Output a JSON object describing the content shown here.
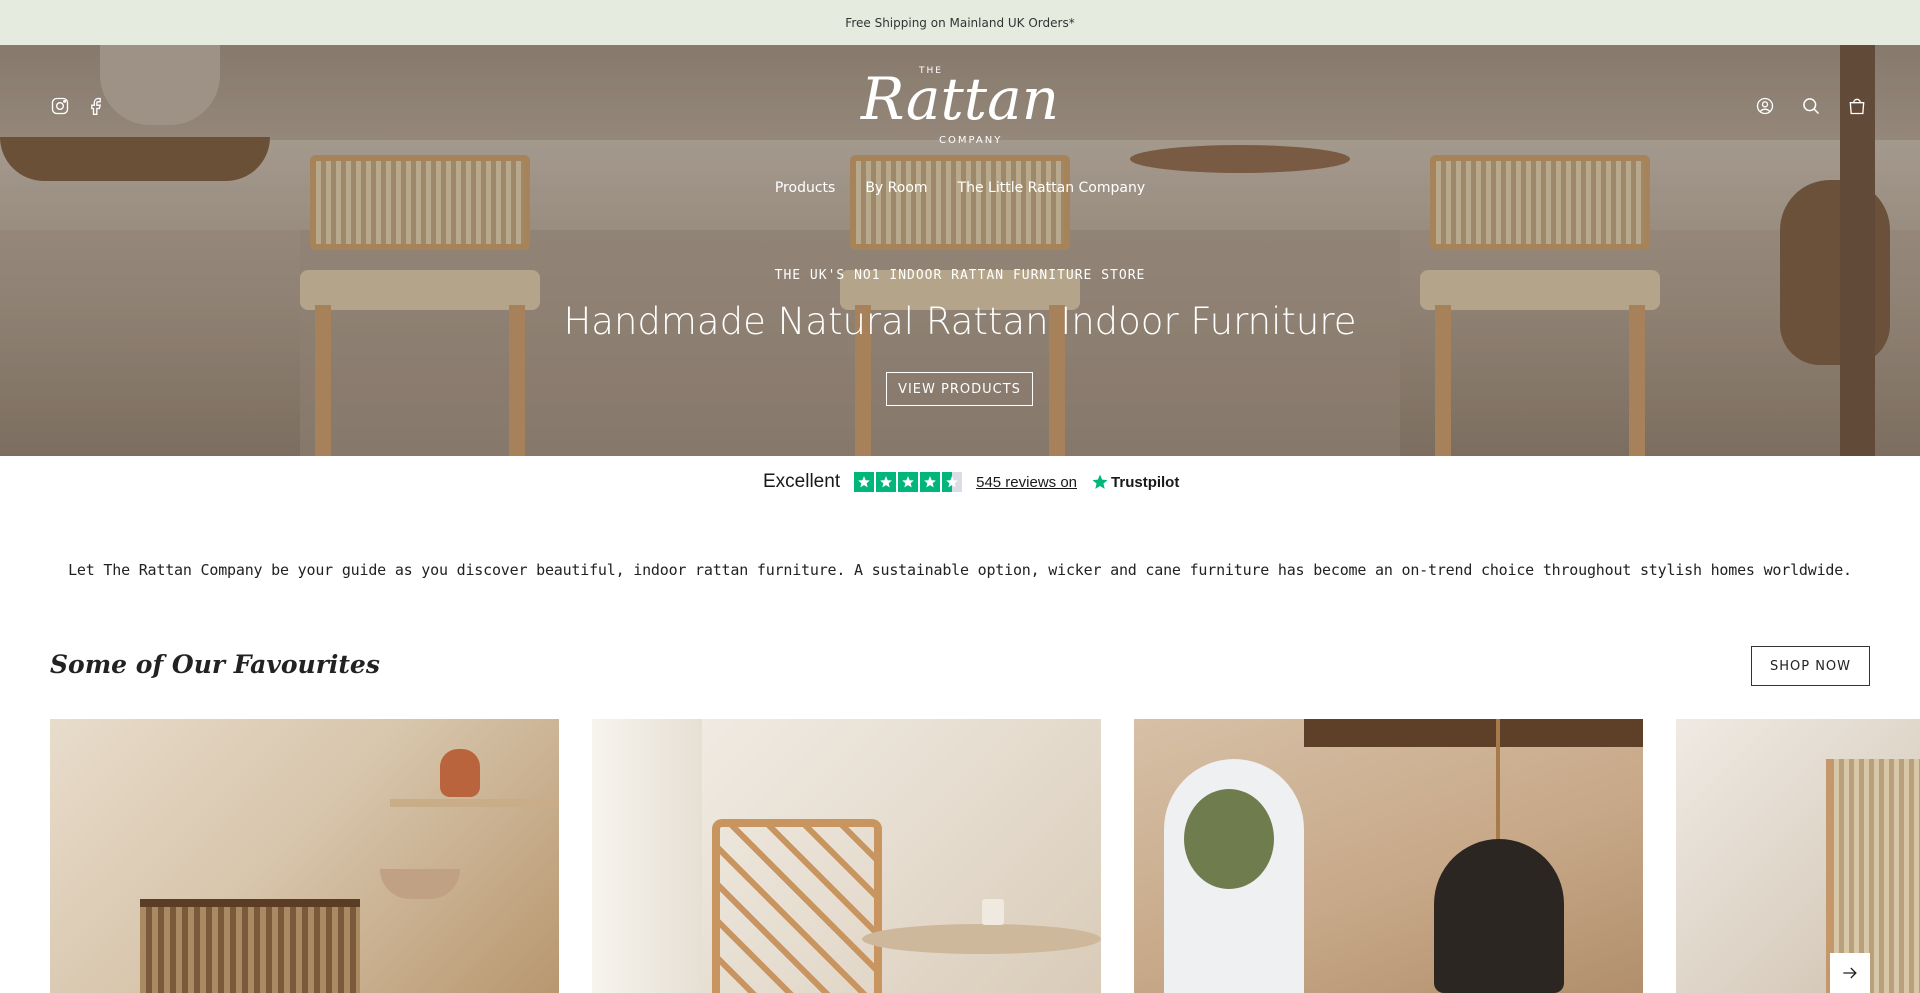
{
  "announcement": {
    "text": "Free Shipping on Mainland UK Orders*"
  },
  "header": {
    "logo": {
      "top": "THE",
      "script": "Rattan",
      "bottom": "COMPANY"
    },
    "social": [
      {
        "icon": "instagram-icon"
      },
      {
        "icon": "facebook-icon"
      }
    ],
    "utility": [
      {
        "icon": "account-icon"
      },
      {
        "icon": "search-icon"
      },
      {
        "icon": "cart-icon"
      }
    ],
    "nav": [
      "Products",
      "By Room",
      "The Little Rattan Company"
    ]
  },
  "hero": {
    "eyebrow": "THE UK'S NO1 INDOOR RATTAN FURNITURE STORE",
    "headline": "Handmade Natural Rattan Indoor Furniture",
    "button": "VIEW PRODUCTS"
  },
  "trustpilot": {
    "rating_text": "Excellent",
    "stars": 4.5,
    "reviews": "545 reviews on",
    "brand": "Trustpilot",
    "brand_color": "#00b67a"
  },
  "intro": {
    "text": "Let The Rattan Company be your guide as you discover beautiful, indoor rattan furniture. A sustainable option, wicker and cane furniture has become an on-trend choice throughout stylish homes worldwide."
  },
  "favourites": {
    "title": "Some of Our Favourites",
    "button": "SHOP NOW",
    "next_icon": "arrow-right-icon"
  },
  "colors": {
    "announcement_bg": "#e6ebe0",
    "text": "#222222"
  }
}
